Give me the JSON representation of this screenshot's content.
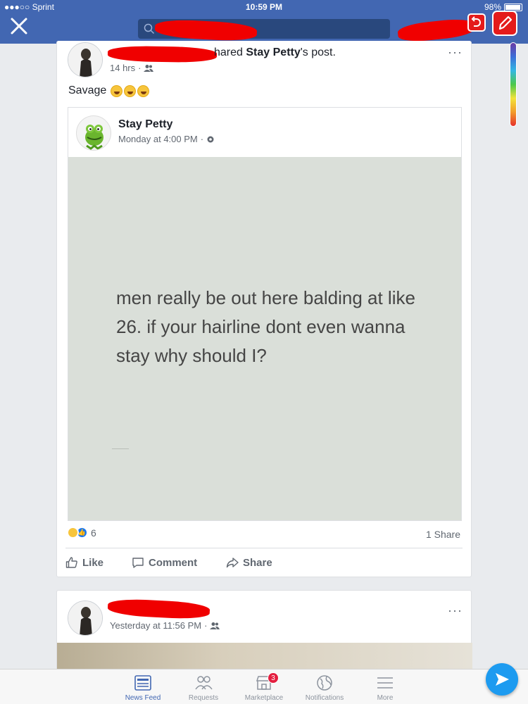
{
  "status_bar": {
    "carrier": "●●●○○ Sprint",
    "time": "10:59 PM",
    "battery": "98%"
  },
  "header": {
    "search_placeholder": "",
    "annotate_undo_icon": "undo-icon",
    "annotate_pen_icon": "pencil-icon"
  },
  "post1": {
    "shared_text_suffix": "hared",
    "shared_page": "Stay Petty",
    "shared_tail": "'s post.",
    "time": "14 hrs",
    "body": "Savage",
    "shared_post": {
      "page_name": "Stay Petty",
      "time": "Monday at 4:00 PM",
      "meme_text": "men really be out here balding at like 26. if your hairline dont even wanna stay why should I?"
    },
    "reaction_count": "6",
    "share_count": "1 Share",
    "actions": {
      "like": "Like",
      "comment": "Comment",
      "share": "Share"
    }
  },
  "post2": {
    "time": "Yesterday at 11:56 PM"
  },
  "tabs": [
    {
      "label": "News Feed",
      "icon": "news-feed-icon"
    },
    {
      "label": "Requests",
      "icon": "friends-icon"
    },
    {
      "label": "Marketplace",
      "icon": "marketplace-icon",
      "badge": "3"
    },
    {
      "label": "Notifications",
      "icon": "globe-icon"
    },
    {
      "label": "More",
      "icon": "menu-icon"
    }
  ],
  "colors": {
    "header": "#4267b2",
    "redaction": "#f00000",
    "accent": "#1877f2"
  }
}
